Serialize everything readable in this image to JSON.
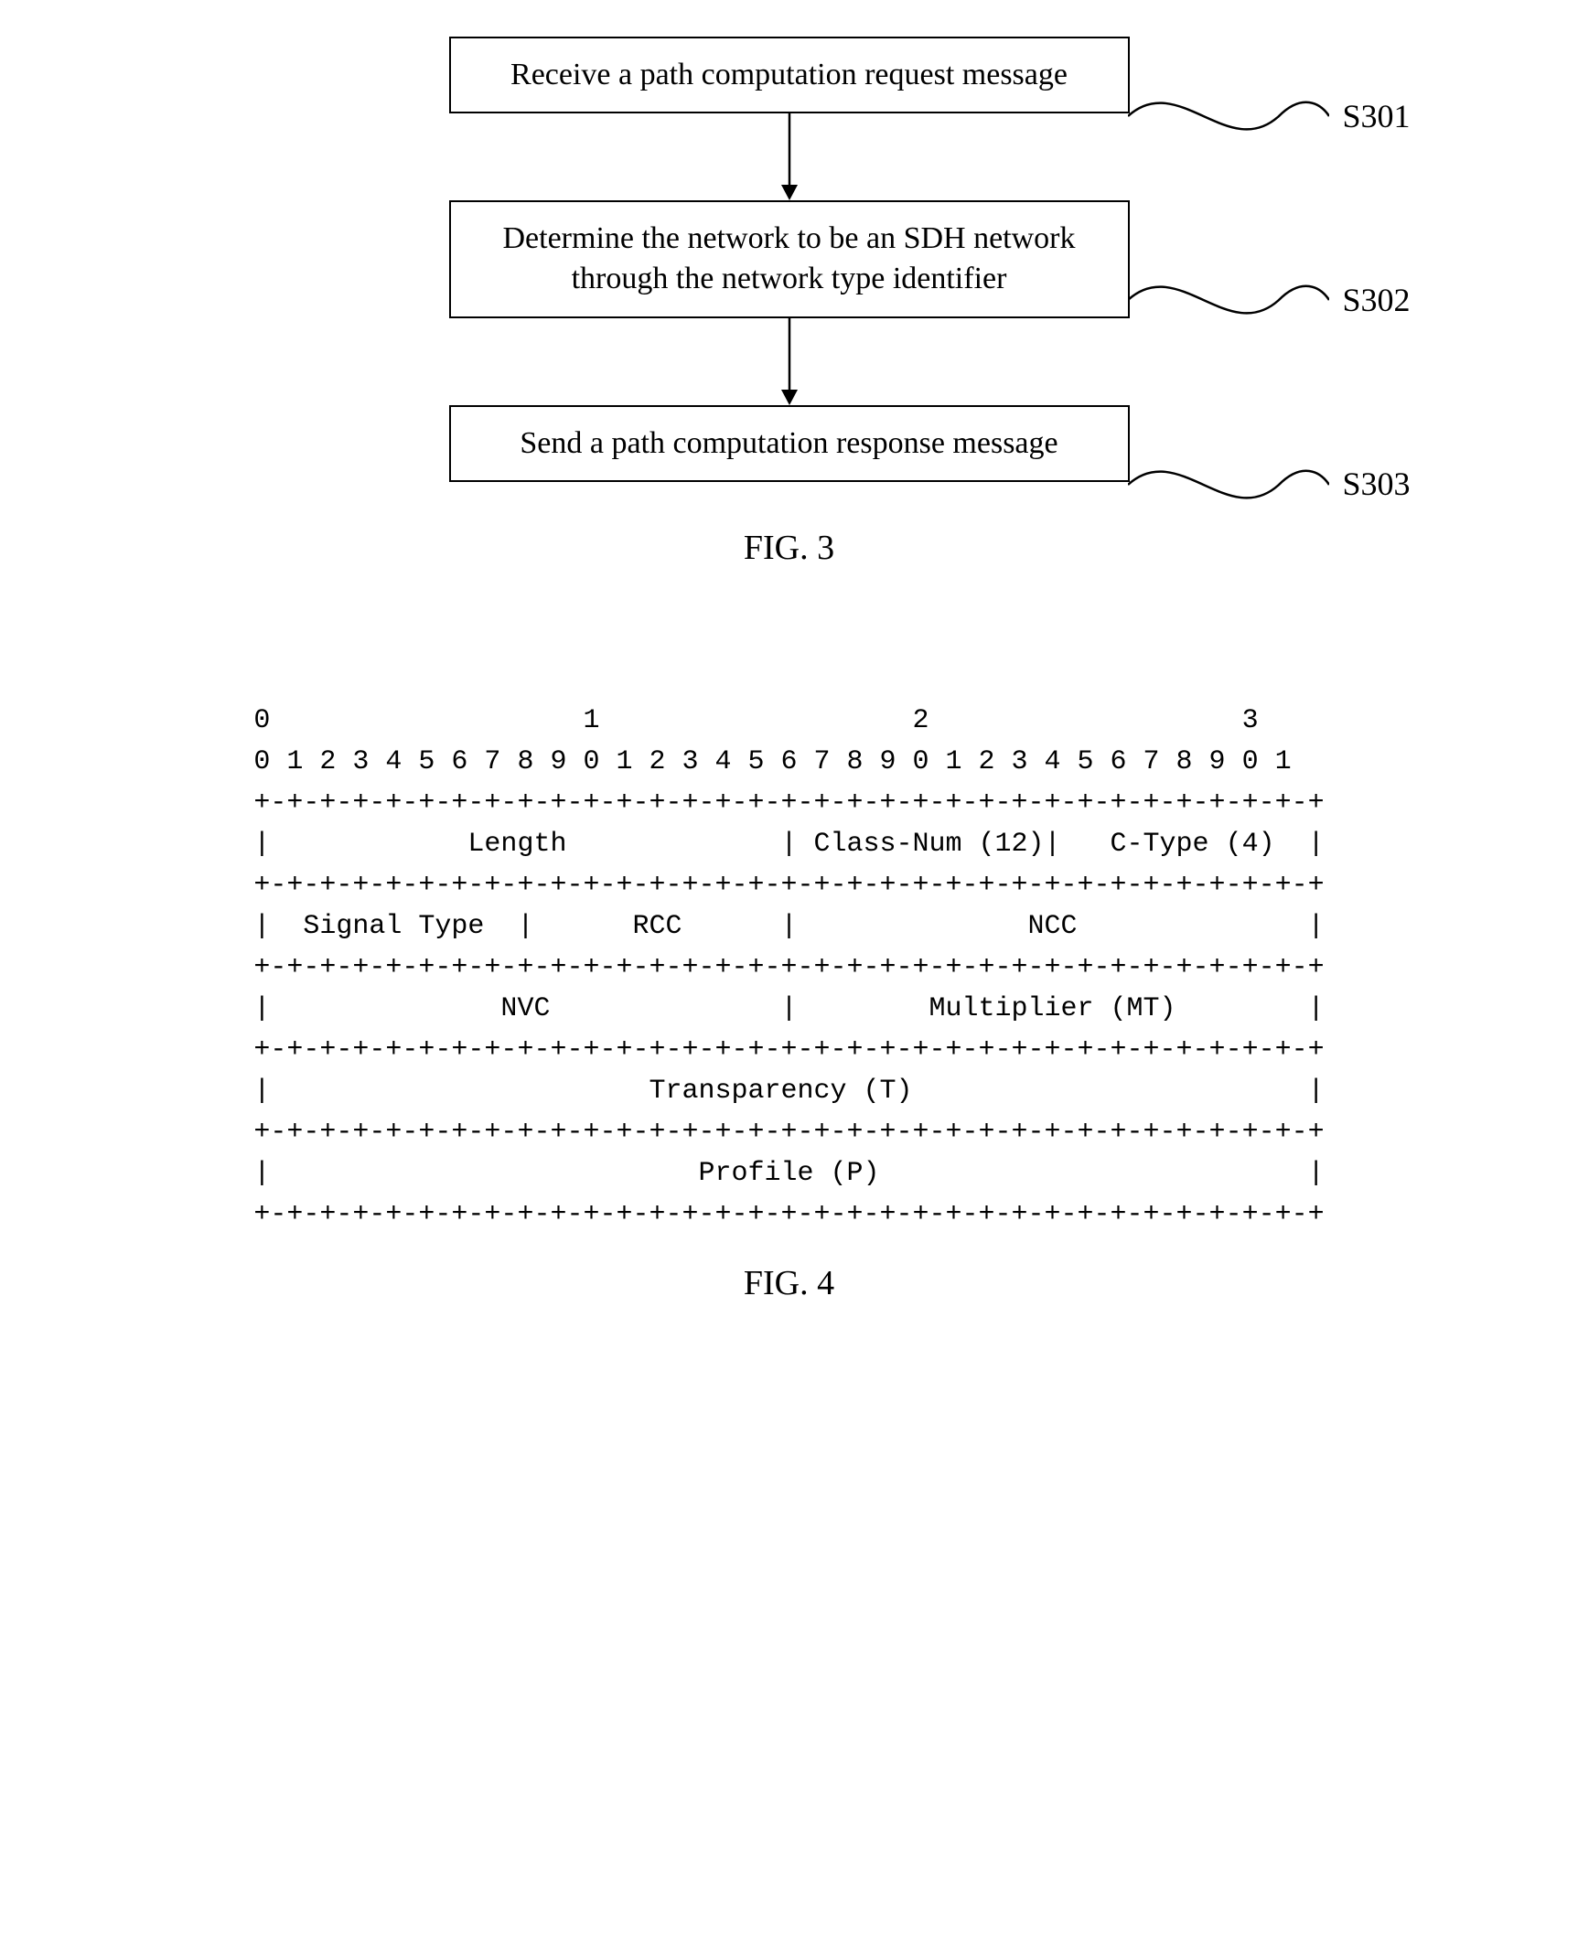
{
  "flow": {
    "steps": [
      {
        "text": "Receive a path computation request message",
        "label": "S301"
      },
      {
        "text": "Determine the network to be an SDH network through the network type identifier",
        "label": "S302"
      },
      {
        "text": "Send a path computation response message",
        "label": "S303"
      }
    ],
    "caption": "FIG. 3"
  },
  "packet": {
    "ruler_top": "0                   1                   2                   3",
    "ruler_bits": "0 1 2 3 4 5 6 7 8 9 0 1 2 3 4 5 6 7 8 9 0 1 2 3 4 5 6 7 8 9 0 1",
    "border": "+-+-+-+-+-+-+-+-+-+-+-+-+-+-+-+-+-+-+-+-+-+-+-+-+-+-+-+-+-+-+-+-+",
    "row1": "|            Length             | Class-Num (12)|   C-Type (4)  |",
    "row2": "|  Signal Type  |      RCC      |              NCC              |",
    "row3": "|              NVC              |        Multiplier (MT)        |",
    "row4": "|                       Transparency (T)                        |",
    "row5": "|                          Profile (P)                          |",
    "caption": "FIG. 4"
  }
}
